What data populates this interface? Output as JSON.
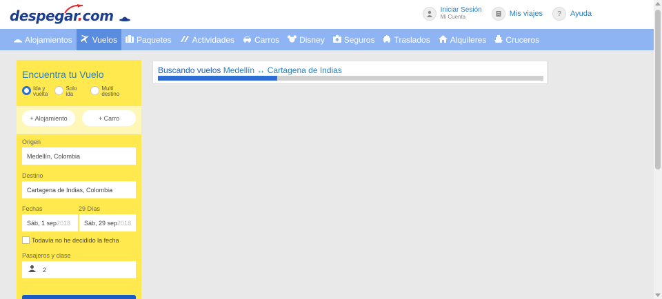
{
  "header": {
    "logo_text": "despegar",
    "logo_com": "com",
    "login_main": "Iniciar Sesión",
    "login_sub": "Mi Cuenta",
    "trips": "Mis viajes",
    "help_icon_glyph": "?",
    "help": "Ayuda"
  },
  "nav": {
    "items": [
      {
        "label": "Alojamientos",
        "icon": "bed-icon"
      },
      {
        "label": "Vuelos",
        "icon": "plane-icon",
        "active": true
      },
      {
        "label": "Paquetes",
        "icon": "package-icon"
      },
      {
        "label": "Actividades",
        "icon": "activities-icon"
      },
      {
        "label": "Carros",
        "icon": "car-icon"
      },
      {
        "label": "Disney",
        "icon": "disney-icon"
      },
      {
        "label": "Seguros",
        "icon": "insurance-icon"
      },
      {
        "label": "Traslados",
        "icon": "transfer-icon"
      },
      {
        "label": "Alquileres",
        "icon": "house-icon"
      },
      {
        "label": "Cruceros",
        "icon": "cruise-icon"
      }
    ]
  },
  "search": {
    "title": "Encuentra tu Vuelo",
    "trip_types": [
      {
        "line1": "Ida y",
        "line2": "vuelta",
        "checked": true
      },
      {
        "line1": "Solo",
        "line2": "ida",
        "checked": false
      },
      {
        "line1": "Multi",
        "line2": "destino",
        "checked": false
      }
    ],
    "add_lodging": "+ Alojamiento",
    "add_car": "+ Carro",
    "origin_label": "Origen",
    "origin_value": "Medellín, Colombia",
    "destination_label": "Destino",
    "destination_value": "Cartagena de Indias, Colombia",
    "dates_label": "Fechas",
    "days_label": "29 Días",
    "depart_value": "Sáb, 1 sep",
    "depart_ghost": " 2018",
    "return_value": "Sáb, 29 sep",
    "return_ghost": " 2018",
    "undecided_label": "Todavía no he decidido la fecha",
    "passengers_label": "Pasajeros y clase",
    "passengers_value": "2"
  },
  "result": {
    "prefix": "Buscando vuelos ",
    "origin": "Medellín",
    "arrow": " ↔ ",
    "destination": "Cartagena de Indias",
    "progress": 0.31
  },
  "colors": {
    "nav_bg": "#8eb4f3",
    "nav_active": "#5a8de0",
    "panel_bg": "#ffe94f",
    "accent": "#2a7fc4",
    "progress": "#2e6ed4"
  }
}
